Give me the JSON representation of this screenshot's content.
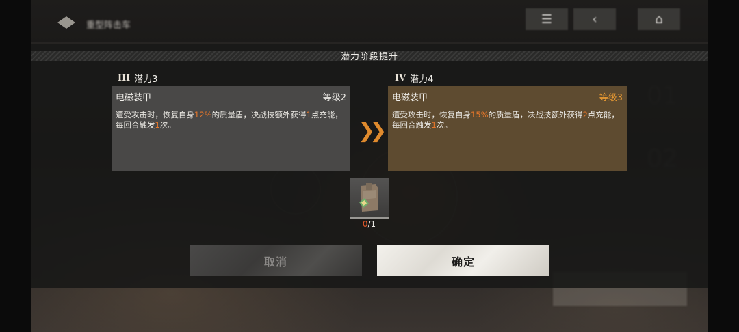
{
  "background": {
    "title": "重型阵击车",
    "ghost_numbers": [
      "01",
      "02"
    ]
  },
  "modal": {
    "title": "潜力阶段提升",
    "current": {
      "roman": "III",
      "label": "潜力3",
      "skill_name": "电磁装甲",
      "grade": "等级2",
      "desc": {
        "p1": "遭受攻击时，恢复自身",
        "v1": "12%",
        "p2": "的质量盾，决战技额外获得",
        "v2": "1",
        "p3": "点充能，每回合触发",
        "v3": "1",
        "p4": "次。"
      }
    },
    "next": {
      "roman": "IV",
      "label": "潜力4",
      "skill_name": "电磁装甲",
      "grade": "等级3",
      "desc": {
        "p1": "遭受攻击时，恢复自身",
        "v1": "15%",
        "p2": "的质量盾，决战技额外获得",
        "v2": "2",
        "p3": "点充能，每回合触发",
        "v3": "1",
        "p4": "次。"
      }
    },
    "arrow_icon": "double-chevron-right-icon",
    "material": {
      "icon": "upgrade-material-icon",
      "owned": "0",
      "required": "/1"
    },
    "buttons": {
      "cancel": "取消",
      "confirm": "确定"
    }
  },
  "colors": {
    "accent_orange": "#e8772a",
    "next_card_bg": "#5e4b30",
    "current_card_bg": "#494847"
  }
}
